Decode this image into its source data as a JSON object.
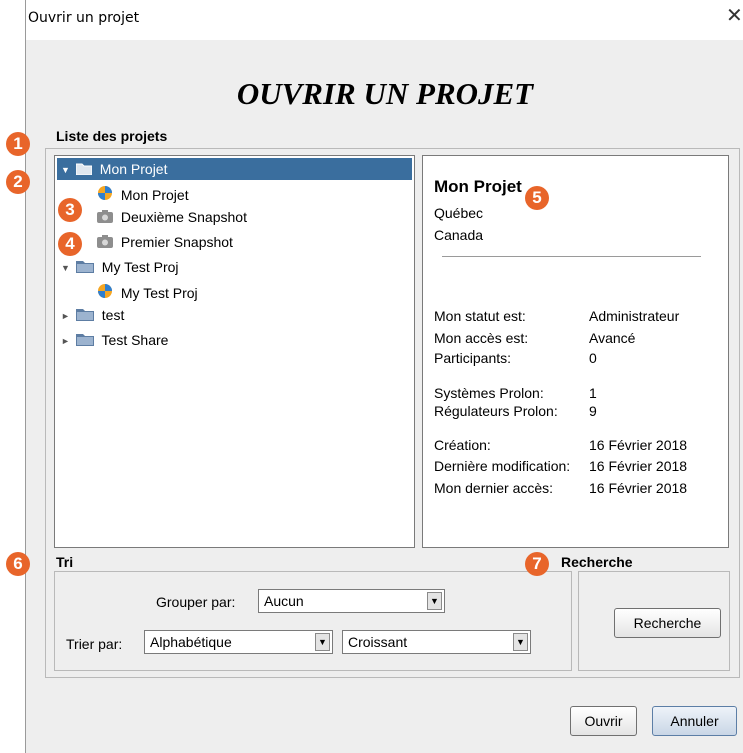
{
  "window": {
    "title": "Ouvrir un projet",
    "close_glyph": "✕"
  },
  "heading": "OUVRIR UN PROJET",
  "project_list_label": "Liste des projets",
  "tree": [
    {
      "label": "Mon Projet",
      "type": "folder",
      "expanded": true,
      "selected": true
    },
    {
      "label": "Mon Projet",
      "type": "project"
    },
    {
      "label": "Deuxième Snapshot",
      "type": "snapshot"
    },
    {
      "label": "Premier Snapshot",
      "type": "snapshot"
    },
    {
      "label": "My Test Proj",
      "type": "folder",
      "expanded": true
    },
    {
      "label": "My Test Proj",
      "type": "project"
    },
    {
      "label": "test",
      "type": "folder",
      "expanded": false
    },
    {
      "label": "Test Share",
      "type": "folder",
      "expanded": false
    }
  ],
  "details": {
    "name": "Mon Projet",
    "location": [
      "Québec",
      "Canada"
    ],
    "rows": [
      {
        "key": "Mon statut est:",
        "value": "Administrateur"
      },
      {
        "key": "Mon accès est:",
        "value": "Avancé"
      },
      {
        "key": "Participants:",
        "value": "0"
      },
      {
        "key": "Systèmes Prolon:",
        "value": "1"
      },
      {
        "key": "Régulateurs Prolon:",
        "value": "9"
      },
      {
        "key": "Création:",
        "value": "16 Février 2018"
      },
      {
        "key": "Dernière modification:",
        "value": "16 Février 2018"
      },
      {
        "key": "Mon dernier accès:",
        "value": "16 Février 2018"
      }
    ]
  },
  "sort": {
    "label": "Tri",
    "group_by_label": "Grouper par:",
    "group_by_value": "Aucun",
    "sort_by_label": "Trier par:",
    "sort_by_value": "Alphabétique",
    "order_value": "Croissant",
    "dropdown_glyph": "▼"
  },
  "search": {
    "label": "Recherche",
    "button": "Recherche"
  },
  "buttons": {
    "open": "Ouvrir",
    "cancel": "Annuler"
  },
  "callouts": [
    "1",
    "2",
    "3",
    "4",
    "5",
    "6",
    "7"
  ],
  "colors": {
    "accent": "#e8652a",
    "selection": "#3a6e9e"
  }
}
